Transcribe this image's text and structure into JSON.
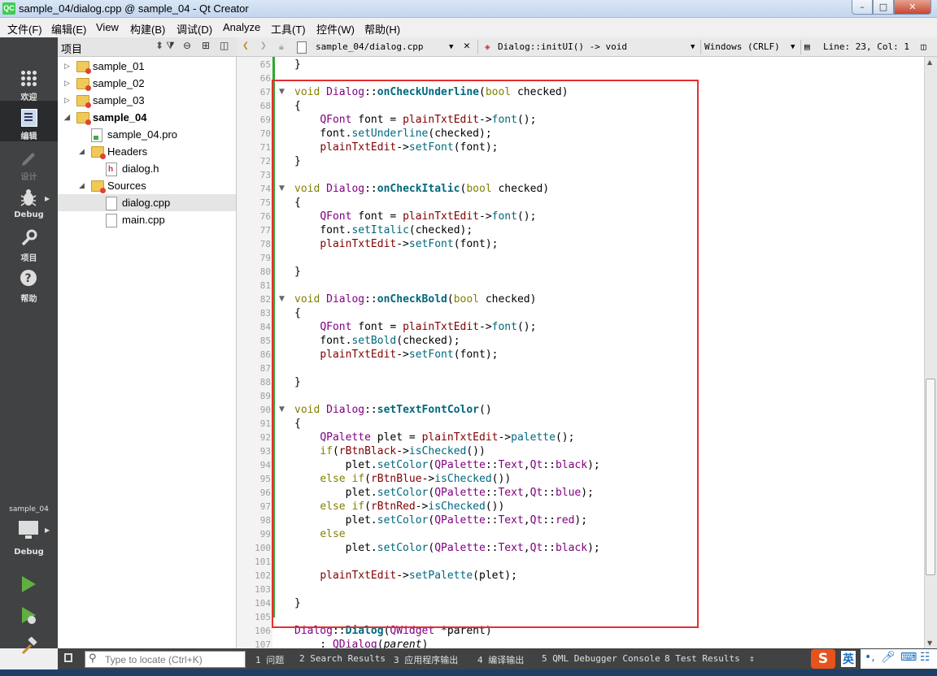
{
  "window": {
    "title": "sample_04/dialog.cpp @ sample_04 - Qt Creator",
    "logo": "QC",
    "controls": {
      "minimize": "–",
      "maximize": "□",
      "close": "✕"
    }
  },
  "menubar": [
    "文件(F)",
    "编辑(E)",
    "View",
    "构建(B)",
    "调试(D)",
    "Analyze",
    "工具(T)",
    "控件(W)",
    "帮助(H)"
  ],
  "modes": [
    {
      "label": "欢迎",
      "icon": "grid-icon"
    },
    {
      "label": "编辑",
      "icon": "document-edit-icon",
      "active": true
    },
    {
      "label": "设计",
      "icon": "pencil-icon",
      "disabled": true
    },
    {
      "label": "Debug",
      "icon": "bug-icon"
    },
    {
      "label": "项目",
      "icon": "wrench-icon"
    },
    {
      "label": "帮助",
      "icon": "help-icon"
    }
  ],
  "kit": {
    "project": "sample_04",
    "mode": "Debug"
  },
  "sidebar": {
    "title": "项目",
    "tree": [
      {
        "label": "sample_01"
      },
      {
        "label": "sample_02"
      },
      {
        "label": "sample_03"
      },
      {
        "label": "sample_04"
      },
      {
        "label": "sample_04.pro"
      },
      {
        "label": "Headers"
      },
      {
        "label": "dialog.h"
      },
      {
        "label": "Sources"
      },
      {
        "label": "dialog.cpp"
      },
      {
        "label": "main.cpp"
      }
    ]
  },
  "editor_toolbar": {
    "file": "sample_04/dialog.cpp",
    "symbol": "Dialog::initUI() -> void",
    "line_ending": "Windows (CRLF)",
    "position": "Line: 23, Col: 1"
  },
  "code_lines": [
    {
      "n": "65",
      "html": "}"
    },
    {
      "n": "66",
      "html": ""
    },
    {
      "n": "67",
      "html": "<span class='kw'>void</span> <span class='typ'>Dialog</span>::<span class='fn'>onCheckUnderline</span>(<span class='kw'>bool</span> checked)",
      "fold": true
    },
    {
      "n": "68",
      "html": "{"
    },
    {
      "n": "69",
      "html": "    <span class='typ'>QFont</span> font = <span class='member'>plainTxtEdit</span>-&gt;<span class='call'>font</span>();"
    },
    {
      "n": "70",
      "html": "    font.<span class='call'>setUnderline</span>(checked);"
    },
    {
      "n": "71",
      "html": "    <span class='member'>plainTxtEdit</span>-&gt;<span class='call'>setFont</span>(font);"
    },
    {
      "n": "72",
      "html": "}"
    },
    {
      "n": "73",
      "html": ""
    },
    {
      "n": "74",
      "html": "<span class='kw'>void</span> <span class='typ'>Dialog</span>::<span class='fn'>onCheckItalic</span>(<span class='kw'>bool</span> checked)",
      "fold": true
    },
    {
      "n": "75",
      "html": "{"
    },
    {
      "n": "76",
      "html": "    <span class='typ'>QFont</span> font = <span class='member'>plainTxtEdit</span>-&gt;<span class='call'>font</span>();"
    },
    {
      "n": "77",
      "html": "    font.<span class='call'>setItalic</span>(checked);"
    },
    {
      "n": "78",
      "html": "    <span class='member'>plainTxtEdit</span>-&gt;<span class='call'>setFont</span>(font);"
    },
    {
      "n": "79",
      "html": ""
    },
    {
      "n": "80",
      "html": "}"
    },
    {
      "n": "81",
      "html": ""
    },
    {
      "n": "82",
      "html": "<span class='kw'>void</span> <span class='typ'>Dialog</span>::<span class='fn'>onCheckBold</span>(<span class='kw'>bool</span> checked)",
      "fold": true
    },
    {
      "n": "83",
      "html": "{"
    },
    {
      "n": "84",
      "html": "    <span class='typ'>QFont</span> font = <span class='member'>plainTxtEdit</span>-&gt;<span class='call'>font</span>();"
    },
    {
      "n": "85",
      "html": "    font.<span class='call'>setBold</span>(checked);"
    },
    {
      "n": "86",
      "html": "    <span class='member'>plainTxtEdit</span>-&gt;<span class='call'>setFont</span>(font);"
    },
    {
      "n": "87",
      "html": ""
    },
    {
      "n": "88",
      "html": "}"
    },
    {
      "n": "89",
      "html": ""
    },
    {
      "n": "90",
      "html": "<span class='kw'>void</span> <span class='typ'>Dialog</span>::<span class='fn'>setTextFontColor</span>()",
      "fold": true
    },
    {
      "n": "91",
      "html": "{"
    },
    {
      "n": "92",
      "html": "    <span class='typ'>QPalette</span> plet = <span class='member'>plainTxtEdit</span>-&gt;<span class='call'>palette</span>();"
    },
    {
      "n": "93",
      "html": "    <span class='kw'>if</span>(<span class='member'>rBtnBlack</span>-&gt;<span class='call'>isChecked</span>())"
    },
    {
      "n": "94",
      "html": "        plet.<span class='call'>setColor</span>(<span class='typ'>QPalette</span>::<span class='typ'>Text</span>,<span class='typ'>Qt</span>::<span class='typ'>black</span>);"
    },
    {
      "n": "95",
      "html": "    <span class='kw'>else</span> <span class='kw'>if</span>(<span class='member'>rBtnBlue</span>-&gt;<span class='call'>isChecked</span>())"
    },
    {
      "n": "96",
      "html": "        plet.<span class='call'>setColor</span>(<span class='typ'>QPalette</span>::<span class='typ'>Text</span>,<span class='typ'>Qt</span>::<span class='typ'>blue</span>);"
    },
    {
      "n": "97",
      "html": "    <span class='kw'>else</span> <span class='kw'>if</span>(<span class='member'>rBtnRed</span>-&gt;<span class='call'>isChecked</span>())"
    },
    {
      "n": "98",
      "html": "        plet.<span class='call'>setColor</span>(<span class='typ'>QPalette</span>::<span class='typ'>Text</span>,<span class='typ'>Qt</span>::<span class='typ'>red</span>);"
    },
    {
      "n": "99",
      "html": "    <span class='kw'>else</span>"
    },
    {
      "n": "100",
      "html": "        plet.<span class='call'>setColor</span>(<span class='typ'>QPalette</span>::<span class='typ'>Text</span>,<span class='typ'>Qt</span>::<span class='typ'>black</span>);"
    },
    {
      "n": "101",
      "html": ""
    },
    {
      "n": "102",
      "html": "    <span class='member'>plainTxtEdit</span>-&gt;<span class='call'>setPalette</span>(plet);"
    },
    {
      "n": "103",
      "html": ""
    },
    {
      "n": "104",
      "html": "}"
    },
    {
      "n": "105",
      "html": ""
    },
    {
      "n": "106",
      "html": "<span class='typ'>Dialog</span>::<span class='fn'>Dialog</span>(<span class='typ'>QWidget</span> *parent)"
    },
    {
      "n": "107",
      "html": "    : <span class='typ'>QDialog</span>(<i>parent</i>)"
    }
  ],
  "statusbar": {
    "locator_placeholder": "Type to locate (Ctrl+K)",
    "tabs": [
      "1 问题",
      "2 Search Results",
      "3 应用程序输出",
      "4 编译输出",
      "5 QML Debugger Console",
      "8 Test Results"
    ],
    "ime": "英"
  },
  "colors": {
    "highlight_box": "#e62e2e",
    "change_bar": "#2ea82e",
    "mode_bar": "#404244"
  }
}
